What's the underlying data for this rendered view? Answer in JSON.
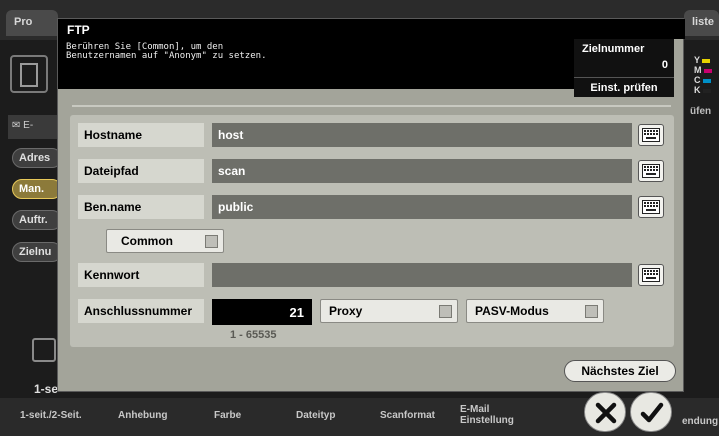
{
  "background": {
    "tabs": [
      "Pro",
      "liste"
    ],
    "email_label": "E-",
    "pills": [
      "Adres",
      "Man.",
      "Auftr.",
      "Zielnu"
    ],
    "bottom_label": "1-se",
    "bottom_bar": [
      "1-seit./2-Seit.",
      "Anhebung",
      "Farbe",
      "Dateityp",
      "Scanformat",
      "E-Mail\nEinstellung",
      "endung"
    ],
    "right_text": "üfen",
    "ymck": [
      "Y",
      "M",
      "C",
      "K"
    ]
  },
  "dialog": {
    "title": "FTP",
    "message_line1": "Berühren Sie [Common], um den",
    "message_line2": "Benutzernamen auf \"Anonym\" zu setzen.",
    "ziel_label": "Zielnummer",
    "ziel_value": "0",
    "einst_button": "Einst. prüfen",
    "fields": {
      "hostname": {
        "label": "Hostname",
        "value": "host"
      },
      "dateipfad": {
        "label": "Dateipfad",
        "value": "scan"
      },
      "benname": {
        "label": "Ben.name",
        "value": "public"
      },
      "kennwort": {
        "label": "Kennwort",
        "value": ""
      },
      "anschluss": {
        "label": "Anschlussnummer",
        "value": "21",
        "range": "1  -  65535"
      }
    },
    "common_label": "Common",
    "proxy_label": "Proxy",
    "pasv_label": "PASV-Modus",
    "next_button": "Nächstes Ziel"
  },
  "icons": {
    "keyboard": "keyboard-icon",
    "cancel": "cancel-x-icon",
    "ok": "checkmark-icon"
  }
}
